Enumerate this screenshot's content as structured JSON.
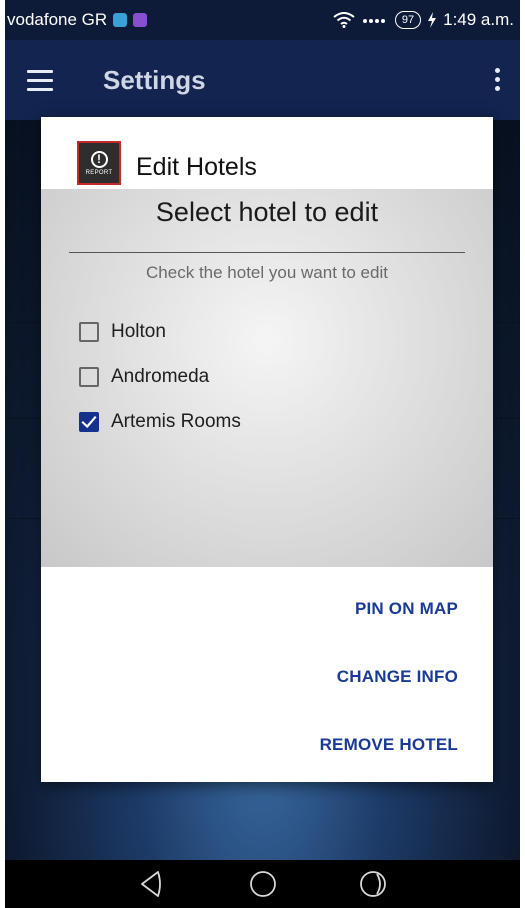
{
  "status_bar": {
    "carrier": "vodafone GR",
    "battery": "97",
    "time": "1:49 a.m."
  },
  "app_bar": {
    "title": "Settings"
  },
  "dialog": {
    "logo_text": "REPORT",
    "title": "Edit Hotels",
    "heading": "Select hotel to edit",
    "subtitle": "Check the hotel you want to edit",
    "hotels": [
      {
        "name": "Holton",
        "checked": false
      },
      {
        "name": "Andromeda",
        "checked": false
      },
      {
        "name": "Artemis Rooms",
        "checked": true
      }
    ],
    "actions": {
      "pin": "PIN ON MAP",
      "change": "CHANGE INFO",
      "remove": "REMOVE HOTEL"
    }
  },
  "colors": {
    "accent": "#1a3a96",
    "checkbox_checked": "#14328c",
    "app_bar": "#12244f"
  }
}
